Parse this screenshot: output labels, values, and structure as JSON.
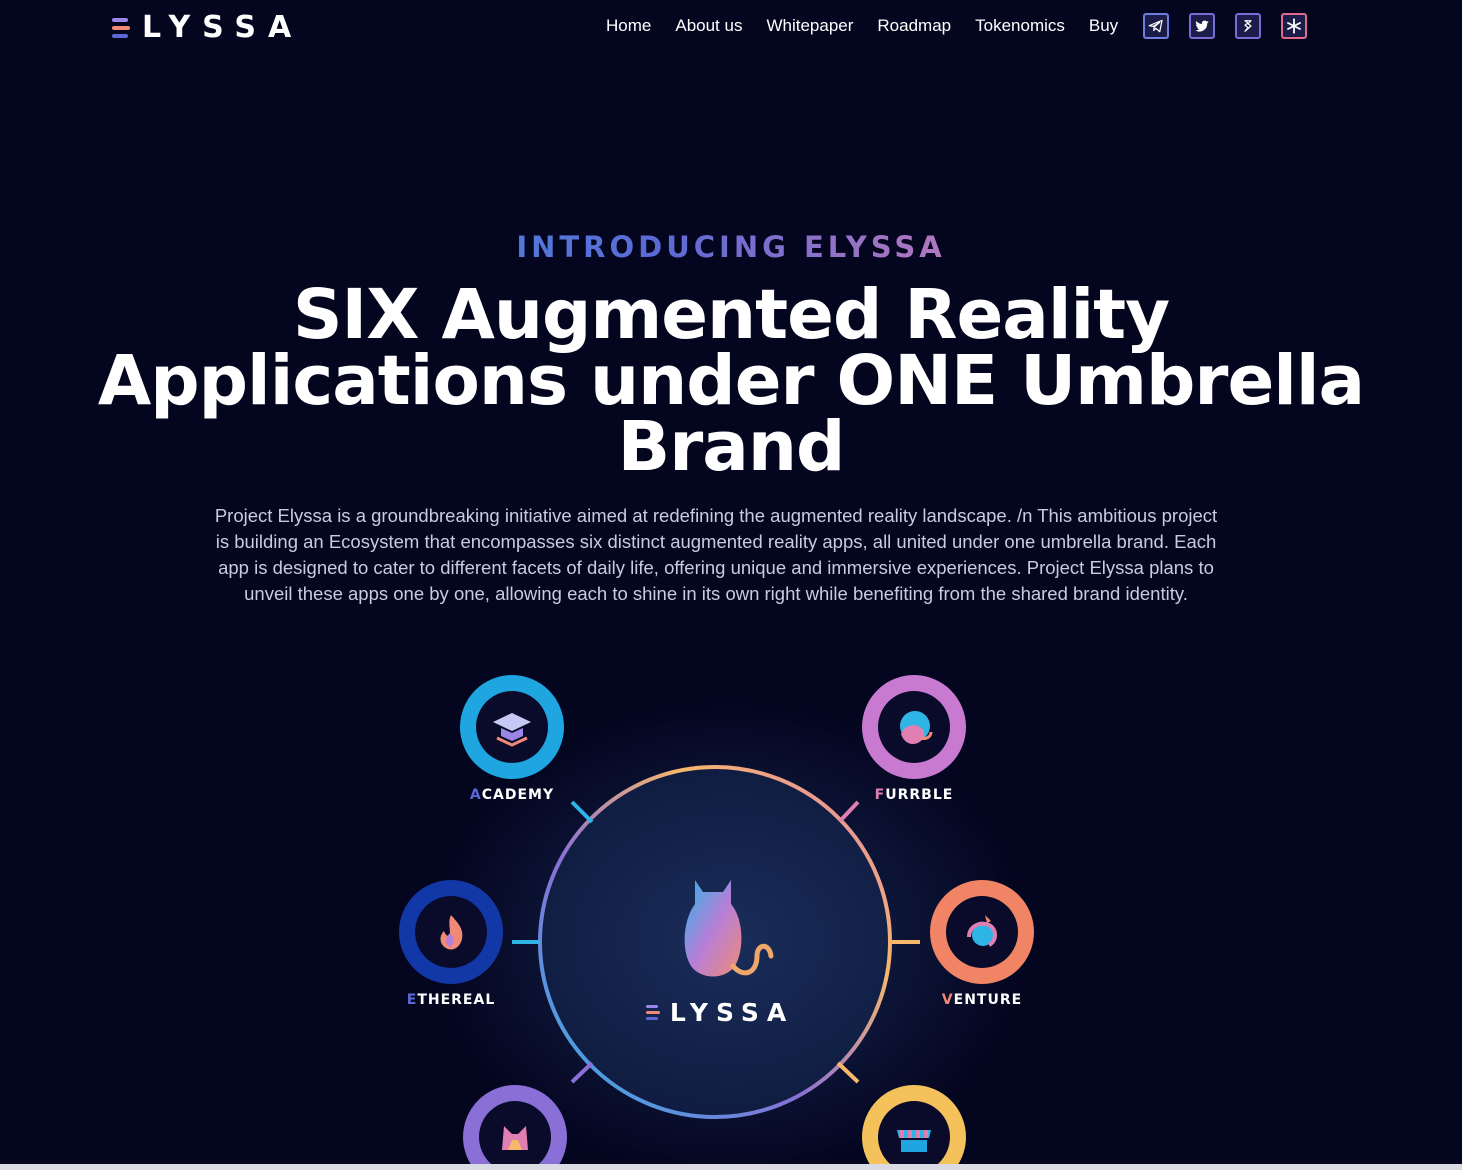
{
  "brand": {
    "name": "LYSSA",
    "mark_colors": [
      "#f08a76",
      "#b57fd8",
      "#2fb4e6"
    ]
  },
  "nav": {
    "items": [
      {
        "label": "Home"
      },
      {
        "label": "About us"
      },
      {
        "label": "Whitepaper"
      },
      {
        "label": "Roadmap"
      },
      {
        "label": "Tokenomics"
      },
      {
        "label": "Buy"
      }
    ],
    "social": [
      {
        "icon": "telegram-icon"
      },
      {
        "icon": "twitter-icon"
      },
      {
        "icon": "dextools-icon"
      },
      {
        "icon": "linktree-icon"
      }
    ]
  },
  "hero": {
    "eyebrow": "INTRODUCING ELYSSA",
    "headline_line1": "SIX Augmented Reality",
    "headline_line2": "Applications under ONE Umbrella",
    "headline_line3": "Brand",
    "intro": "Project Elyssa is a groundbreaking initiative aimed at redefining the augmented reality landscape. /n This ambitious project is building an Ecosystem that encompasses six distinct augmented reality apps, all united under one umbrella brand. Each app is designed to cater to different facets of daily life, offering unique and immersive experiences. Project Elyssa plans to unveil these apps one by one, allowing each to shine in its own right while benefiting from the shared brand identity."
  },
  "ecosystem": {
    "center_label": "LYSSA",
    "apps": [
      {
        "label": "CADEMY",
        "prefix": "A",
        "icon": "graduation-cap-icon",
        "color": "#1fa6e0"
      },
      {
        "label": "URRBLE",
        "prefix": "F",
        "icon": "pet-globe-icon",
        "color": "#c77ad0"
      },
      {
        "label": "THEREAL",
        "prefix": "E",
        "icon": "flame-icon",
        "color": "#1238a8"
      },
      {
        "label": "ENTURE",
        "prefix": "V",
        "icon": "travel-globe-icon",
        "color": "#f28466"
      },
      {
        "label": "",
        "prefix": "",
        "icon": "cat-face-icon",
        "color": "#8a6fd6"
      },
      {
        "label": "",
        "prefix": "",
        "icon": "storefront-icon",
        "color": "#f4c15a"
      }
    ]
  }
}
